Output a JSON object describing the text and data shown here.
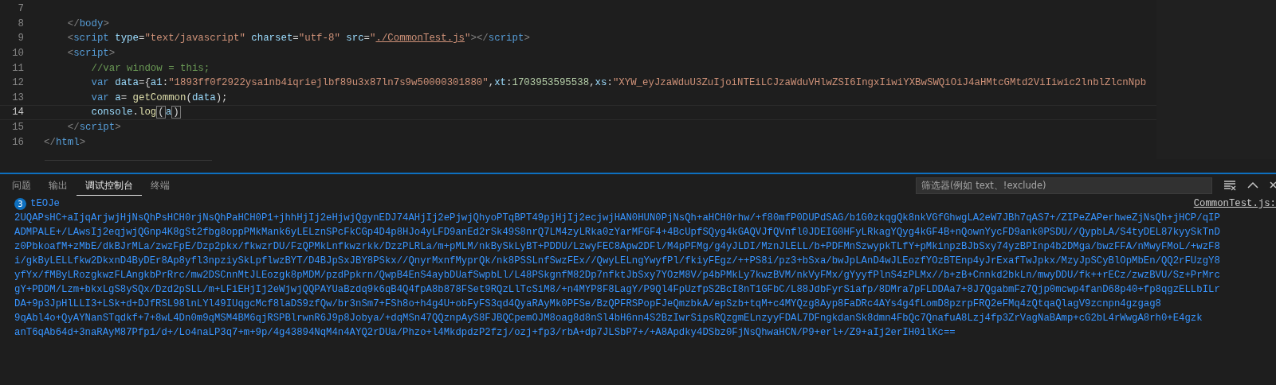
{
  "editor": {
    "lines": [
      {
        "number": "7",
        "current": false
      },
      {
        "number": "8",
        "current": false,
        "tokens": [
          {
            "t": "    </",
            "kind": "punct"
          },
          {
            "t": "body",
            "kind": "tag"
          },
          {
            "t": ">",
            "kind": "punct"
          }
        ]
      },
      {
        "number": "9",
        "current": false,
        "tokens": [
          {
            "t": "    <",
            "kind": "punct"
          },
          {
            "t": "script",
            "kind": "tag"
          },
          {
            "t": " type",
            "kind": "attr"
          },
          {
            "t": "="
          },
          {
            "t": "\"text/javascript\"",
            "kind": "string"
          },
          {
            "t": " charset",
            "kind": "attr"
          },
          {
            "t": "="
          },
          {
            "t": "\"utf-8\"",
            "kind": "string"
          },
          {
            "t": " src",
            "kind": "attr"
          },
          {
            "t": "="
          },
          {
            "t": "\"",
            "kind": "string"
          },
          {
            "t": "./CommonTest.js",
            "kind": "link"
          },
          {
            "t": "\"",
            "kind": "string"
          },
          {
            "t": "></",
            "kind": "punct"
          },
          {
            "t": "script",
            "kind": "tag"
          },
          {
            "t": ">",
            "kind": "punct"
          }
        ]
      },
      {
        "number": "10",
        "current": false,
        "tokens": [
          {
            "t": "    <",
            "kind": "punct"
          },
          {
            "t": "script",
            "kind": "tag"
          },
          {
            "t": ">",
            "kind": "punct"
          }
        ]
      },
      {
        "number": "11",
        "current": false,
        "tokens": [
          {
            "t": "        //var window = this;",
            "kind": "comment"
          }
        ]
      },
      {
        "number": "12",
        "current": false,
        "tokens": [
          {
            "t": "        var",
            "kind": "keyword"
          },
          {
            "t": " data",
            "kind": "variable"
          },
          {
            "t": "={"
          },
          {
            "t": "a1",
            "kind": "variable"
          },
          {
            "t": ":"
          },
          {
            "t": "\"1893ff0f2922ysa1nb4iqriejlbf89u3x87ln7s9w50000301880\"",
            "kind": "string"
          },
          {
            "t": ","
          },
          {
            "t": "xt",
            "kind": "variable"
          },
          {
            "t": ":"
          },
          {
            "t": "1703953595538",
            "kind": "number"
          },
          {
            "t": ","
          },
          {
            "t": "xs",
            "kind": "variable"
          },
          {
            "t": ":"
          },
          {
            "t": "\"XYW_eyJzaWduU3ZuIjoiNTEiLCJzaWduVHlwZSI6IngxIiwiYXBwSWQiOiJ4aHMtcGMtd2ViIiwic2lnblZlcnNpb",
            "kind": "string"
          }
        ]
      },
      {
        "number": "13",
        "current": false,
        "tokens": [
          {
            "t": "        var",
            "kind": "keyword"
          },
          {
            "t": " a",
            "kind": "variable"
          },
          {
            "t": "= "
          },
          {
            "t": "getCommon",
            "kind": "function"
          },
          {
            "t": "("
          },
          {
            "t": "data",
            "kind": "variable"
          },
          {
            "t": ");"
          }
        ]
      },
      {
        "number": "14",
        "current": true,
        "tokens": [
          {
            "t": "        console",
            "kind": "variable"
          },
          {
            "t": "."
          },
          {
            "t": "log",
            "kind": "function"
          },
          {
            "t": "(",
            "kind": "bracket-match"
          },
          {
            "t": "a",
            "kind": "variable"
          },
          {
            "t": ")",
            "kind": "bracket-match"
          }
        ]
      },
      {
        "number": "15",
        "current": false,
        "tokens": [
          {
            "t": "    </",
            "kind": "punct"
          },
          {
            "t": "script",
            "kind": "tag"
          },
          {
            "t": ">",
            "kind": "punct"
          }
        ]
      },
      {
        "number": "16",
        "current": false,
        "tokens": [
          {
            "t": "</",
            "kind": "punct"
          },
          {
            "t": "html",
            "kind": "tag"
          },
          {
            "t": ">",
            "kind": "punct"
          }
        ]
      }
    ]
  },
  "panel": {
    "tabs": [
      {
        "label": "问题",
        "selected": false
      },
      {
        "label": "输出",
        "selected": false
      },
      {
        "label": "调试控制台",
        "selected": true
      },
      {
        "label": "终端",
        "selected": false
      }
    ],
    "filter": {
      "placeholder": "筛选器(例如 text、!exclude)"
    },
    "console": {
      "count": "3",
      "first_line": "tEOJe",
      "source": "CommonTest.js:",
      "lines": [
        "2UQAPsHC+aIjqArjwjHjNsQhPsHCH0rjNsQhPaHCH0P1+jhhHjIj2eHjwjQgynEDJ74AHjIj2ePjwjQhyoPTqBPT49pjHjIj2ecjwjHAN0HUN0PjNsQh+aHCH0rhw/+f80mfP0DUPdSAG/b1G0zkqgQk8nkVGfGhwgLA2eW7JBh7qAS7+/ZIPeZAPerhweZjNsQh+jHCP/qIP",
        "ADMPALE+/LAwsIj2eqjwjQGnp4K8gSt2fbg8oppPMkMank6yLELznSPcFkCGp4D4p8HJo4yLFD9anEd2rSk49S8nrQ7LM4zyLRka0zYarMFGF4+4BcUpfSQyg4kGAQVJfQVnfl0JDEIG0HFyLRkagYQyg4kGF4B+nQownYycFD9ank0PSDU//QypbLA/S4tyDEL87kyySkTnD",
        "z0PbkoafM+zMbE/dkBJrMLa/zwzFpE/Dzp2pkx/fkwzrDU/FzQPMkLnfkwzrkk/DzzPLRLa/m+pMLM/nkBySkLyBT+PDDU/LzwyFEC8Apw2DFl/M4pPFMg/g4yJLDI/MznJLELL/b+PDFMnSzwypkTLfY+pMkinpzBJbSxy74yzBPInp4b2DMga/bwzFFA/nMwyFMoL/+wzF8",
        "i/gkByLELLfkw2DkxnD4ByDEr8Ap8yfl3npziySkLpflwzBYT/D4BJpSxJBY8PSkx//QnyrMxnfMyprQk/nk8PSSLnfSwzFEx//QwyLELngYwyfPl/fkiyFEgz/++PS8i/pz3+bSxa/bwJpLAnD4wJLEozfYOzBTEnp4yJrExafTwJpkx/MzyJpSCyBlOpMbEn/QQ2rFUzgY8",
        "yfYx/fMByLRozgkwzFLAngkbPrRrc/mw2DSCnnMtJLEozgk8pMDM/pzdPpkrn/QwpB4EnS4aybDUafSwpbLl/L48PSkgnfM82Dp7nfktJbSxy7YOzM8V/p4bPMkLy7kwzBVM/nkVyFMx/gYyyfPlnS4zPLMx//b+zB+Cnnkd2bkLn/mwyDDU/fk++rECz/zwzBVU/Sz+PrMrc",
        "gY+PDDM/Lzm+bkxLgS8ySQx/Dzd2pSLL/m+LFiEHjIj2eWjwjQQPAYUaBzdq9k6qB4Q4fpA8b878FSet9RQzLlTcSiM8/+n4MYP8F8LagY/P9Ql4FpUzfpS2BcI8nT1GFbC/L88JdbFyrSiafp/8DMra7pFLDDAa7+8J7QgabmFz7Qjp0mcwp4fanD68p40+fp8qgzELLbILr",
        "DA+9p3JpHlLLI3+LSk+d+DJfRSL98lnLYl49IUqgcMcf8laDS9zfQw/br3nSm7+FSh8o+h4g4U+obFyFS3qd4QyaRAyMk0PFSe/BzQPFRSPopFJeQmzbkA/epSzb+tqM+c4MYQzg8Ayp8FaDRc4AYs4g4fLomD8pzrpFRQ2eFMq4zQtqaQlagV9zcnpn4gzgag8",
        "9qAbl4o+QyAYNanSTqdkf+7+8wL4Dn0m9qMSM4BM6qjRSPBlrwnR6J9p8Jobya/+dqMSn47QQznpAyS8FJBQCpemOJM8oag8d8nSl4bH6nn4S2BzIwrSipsRQzgmELnzyyFDAL7DFngkdanSk8dmn4FbQc7QnafuA8Lzj4fp3ZrVagNaBAmp+cG2bL4rWwgA8rh0+E4gzk",
        "anT6qAb64d+3naRAyM87Pfp1/d+/Lo4naLP3q7+m+9p/4g43894NqM4n4AYQ2rDUa/Phzo+l4MkdpdzP2fzj/ozj+fp3/rbA+dp7JLSbP7+/+A8Apdky4DSbz0FjNsQhwaHCN/P9+erl+/Z9+aIj2erIH0ilKc=="
      ]
    }
  }
}
